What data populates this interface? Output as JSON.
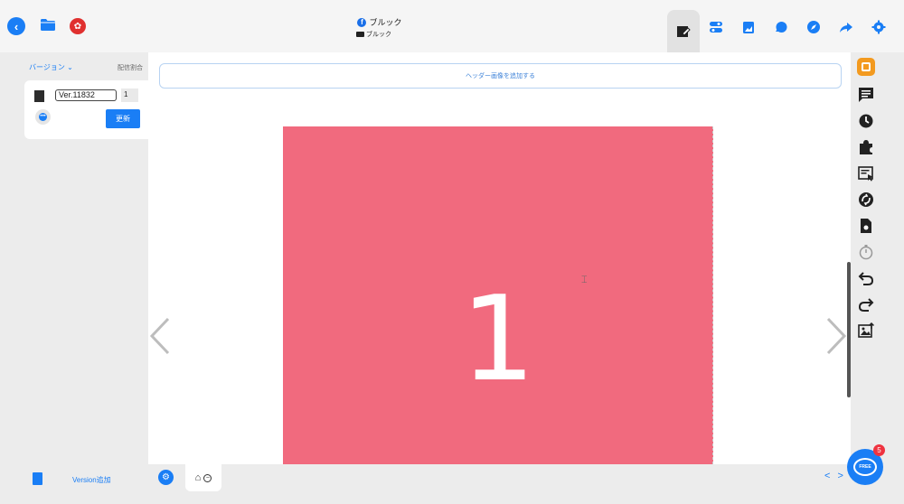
{
  "header": {
    "page_title": "ブルック",
    "page_subtitle": "ブルック"
  },
  "left_panel": {
    "version_dropdown_label": "バージョン",
    "distribution_ratio_label": "配信割合",
    "version_value": "Ver.11832",
    "ratio_value": "1",
    "update_button_label": "更新",
    "add_version_label": "Version追加"
  },
  "canvas": {
    "header_image_add_label": "ヘッダー画像を追加する",
    "slide_number": "1"
  },
  "tabs": [
    "edit-icon",
    "toggle-icon",
    "bookmark-icon",
    "chat-icon",
    "compass-icon",
    "share-icon",
    "settings-icon"
  ],
  "tools": [
    "app-icon",
    "comment-icon",
    "history-icon",
    "puzzle-icon",
    "text-select-icon",
    "sync-icon",
    "doc-settings-icon",
    "timer-icon",
    "undo-icon",
    "redo-icon",
    "image-upload-icon"
  ],
  "chat": {
    "label": "FREE",
    "badge_count": "5"
  },
  "colors": {
    "accent": "#1a7ef5",
    "slide_background": "#f16a7e",
    "brand": "#e0302f"
  }
}
